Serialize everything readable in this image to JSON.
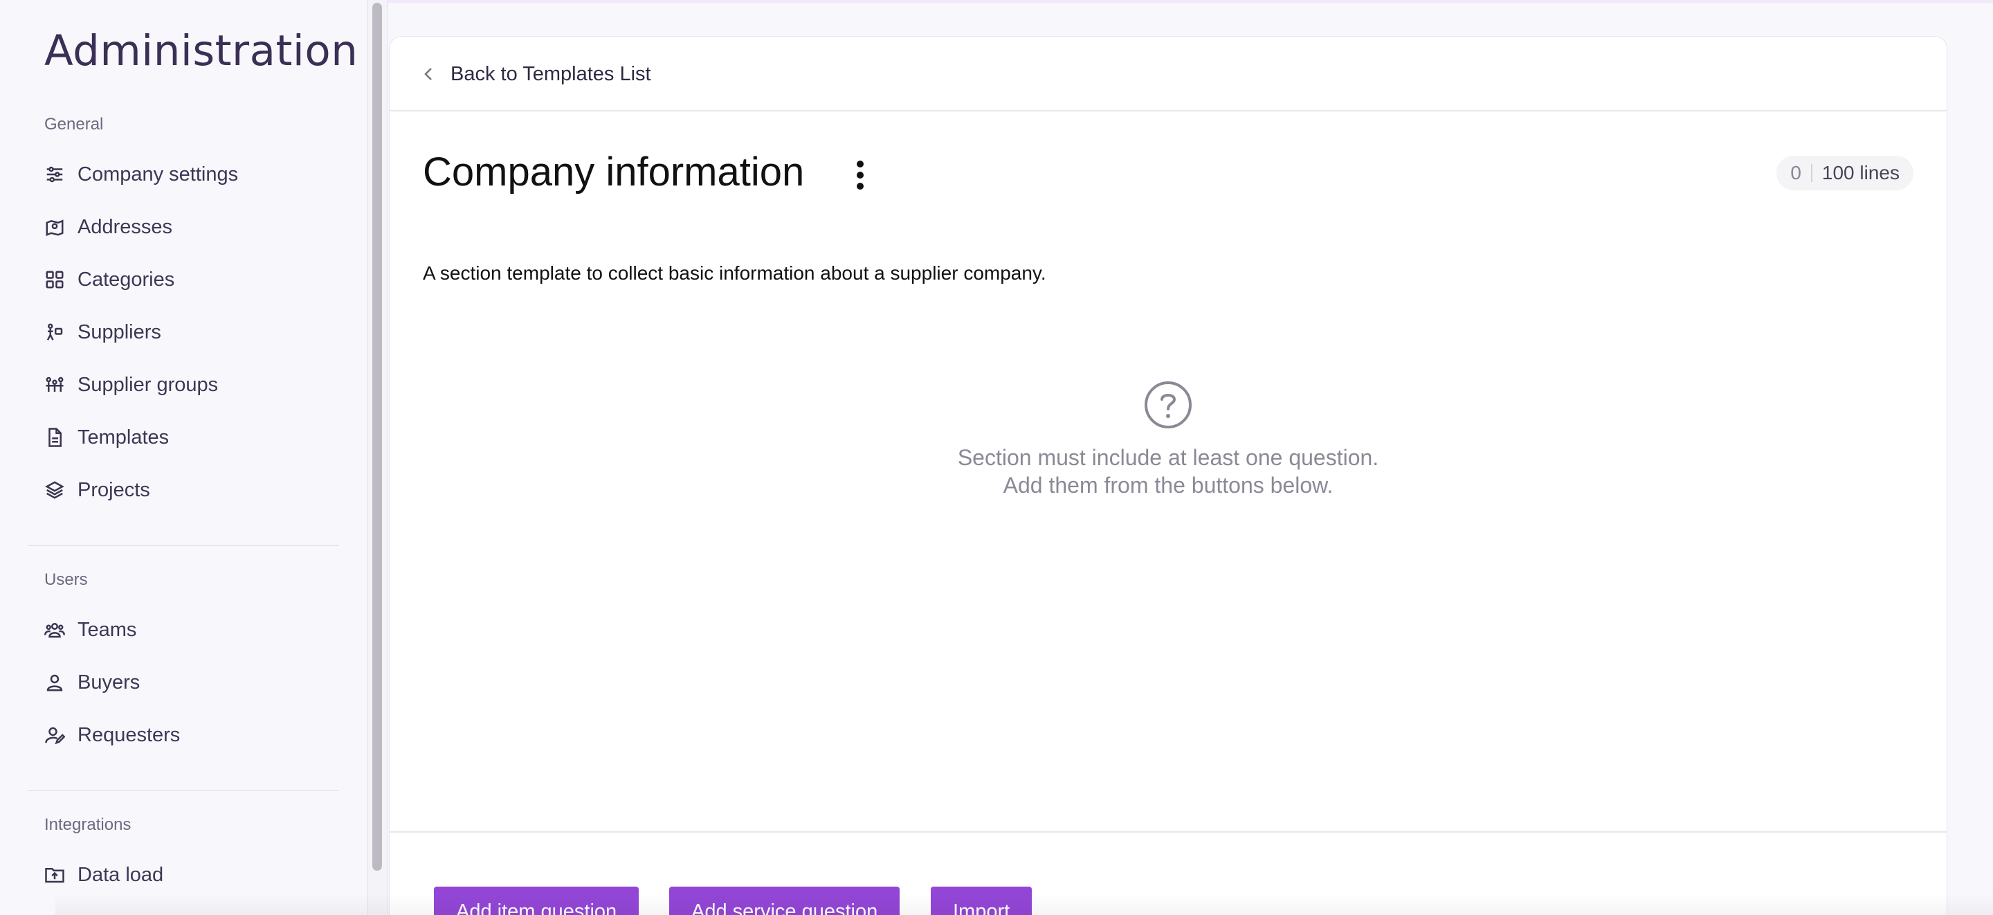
{
  "sidebar": {
    "title": "Administration",
    "sections": [
      {
        "label": "General",
        "items": [
          {
            "label": "Company settings",
            "icon": "sliders-icon"
          },
          {
            "label": "Addresses",
            "icon": "map-pin-icon"
          },
          {
            "label": "Categories",
            "icon": "grid-icon"
          },
          {
            "label": "Suppliers",
            "icon": "supplier-icon"
          },
          {
            "label": "Supplier groups",
            "icon": "supplier-groups-icon"
          },
          {
            "label": "Templates",
            "icon": "document-icon"
          },
          {
            "label": "Projects",
            "icon": "layers-icon"
          }
        ]
      },
      {
        "label": "Users",
        "items": [
          {
            "label": "Teams",
            "icon": "team-icon"
          },
          {
            "label": "Buyers",
            "icon": "user-icon"
          },
          {
            "label": "Requesters",
            "icon": "user-edit-icon"
          }
        ]
      },
      {
        "label": "Integrations",
        "items": [
          {
            "label": "Data load",
            "icon": "folder-upload-icon"
          }
        ]
      }
    ]
  },
  "header": {
    "back_label": "Back to Templates List"
  },
  "main": {
    "title": "Company information",
    "description": "A section template to collect basic information about a supplier company.",
    "lines_badge": {
      "count": "0",
      "total": "100 lines"
    },
    "empty_state": {
      "line1": "Section must include at least one question.",
      "line2": "Add them from the buttons below."
    }
  },
  "footer": {
    "add_item_label": "Add item question",
    "add_service_label": "Add service question",
    "import_label": "Import"
  },
  "colors": {
    "accent": "#9346d6",
    "sidebar_bg": "#f8f7fb",
    "title": "#3a2f55"
  }
}
